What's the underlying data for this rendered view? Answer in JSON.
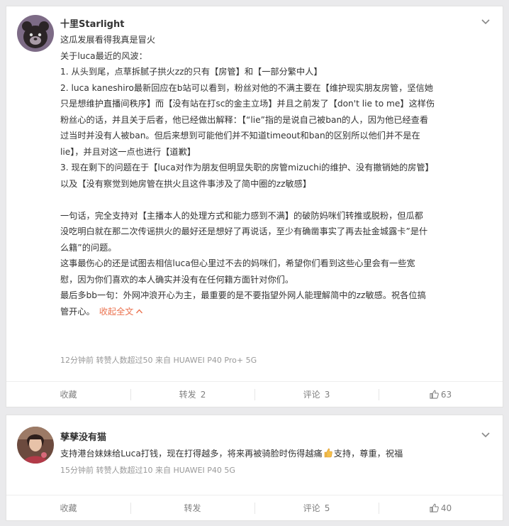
{
  "posts": [
    {
      "user": {
        "name": "十里Starlight"
      },
      "lines": [
        "这瓜发展看得我真是冒火",
        "关于luca最近的风波：",
        "1. 从头到尾，点草拆腻子拱火zz的只有【房管】和【一部分繁中人】",
        "2. luca kaneshiro最新回应在b站可以看到，粉丝对他的不满主要在【维护现实朋友房管，坚信她",
        "只是想维护直播间秩序】而【没有站在打sc的金主立场】并且之前发了【don't lie to me】这样伤",
        "粉丝心的话，并且关于后者，他已经做出解释：【“lie”指的是说自己被ban的人，因为他已经查看",
        "过当时并没有人被ban。但后来想到可能他们并不知道timeout和ban的区别所以他们并不是在",
        "lie】，并且对这一点也进行【道歉】",
        "3. 现在剩下的问题在于【luca对作为朋友但明显失职的房管mizuchi的维护、没有撤销她的房管】",
        "以及【没有察觉到她房管在拱火且这件事涉及了简中圈的zz敏感】",
        "",
        "一句话，完全支持对【主播本人的处理方式和能力感到不满】的破防妈咪们转推或脱粉，但瓜都",
        "没吃明白就在那二次传谣拱火的最好还是想好了再说话，至少有确凿事实了再去扯金城露卡”是什",
        "么籍”的问题。",
        "这事最伤心的还是试图去相信luca但心里过不去的妈咪们，希望你们看到这些心里会有一些宽",
        "慰，因为你们喜欢的本人确实并没有在任何籍方面针对你们。",
        "最后多bb一句：外网冲浪开心为主，最重要的是不要指望外网人能理解简中的zz敏感。祝各位搞"
      ],
      "last_line": "管开心。",
      "collapse": "收起全文",
      "meta": "12分钟前  转赞人数超过50  来自 HUAWEI P40 Pro+ 5G",
      "actions": {
        "favorite": "收藏",
        "repost": "转发",
        "repost_count": "2",
        "comment": "评论",
        "comment_count": "3",
        "likes": "63"
      }
    },
    {
      "user": {
        "name": "孳孳没有猫"
      },
      "text_before": "支持港台妹妹给Luca打钱，现在打得越多，将来再被骑脸时伤得越痛",
      "text_after": "支持，尊重，祝福",
      "emoji": "thumbs-up-emoji",
      "meta": "15分钟前  转赞人数超过10  来自 HUAWEI P40 5G",
      "actions": {
        "favorite": "收藏",
        "repost": "转发",
        "comment": "评论",
        "comment_count": "5",
        "likes": "40"
      }
    }
  ],
  "colors": {
    "accent": "#eb7350",
    "meta": "#999999",
    "action": "#808080"
  }
}
